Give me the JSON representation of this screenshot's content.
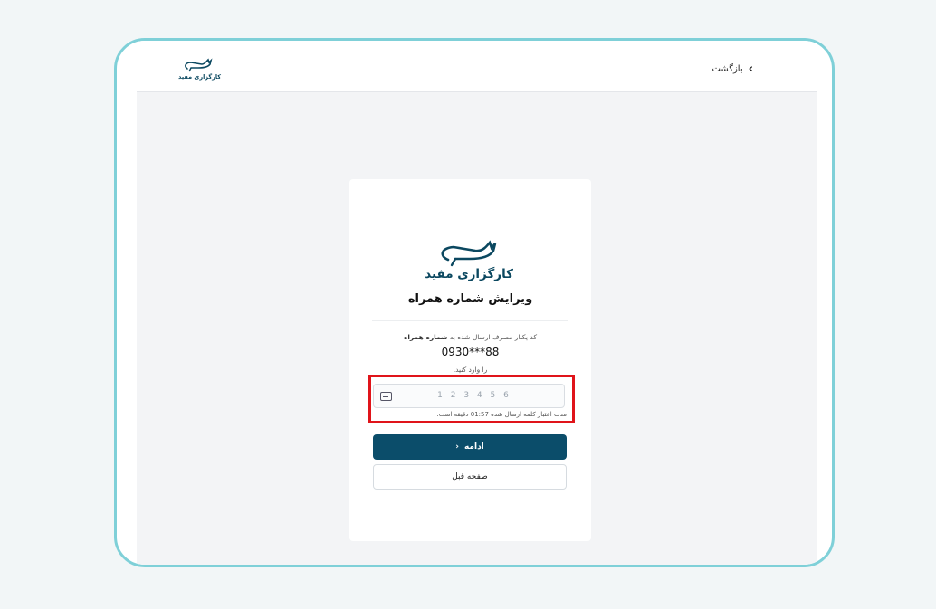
{
  "header": {
    "logo_text": "کارگزاری مفید",
    "back_label": "بازگشت"
  },
  "card": {
    "logo_text": "کارگزاری مفید",
    "title": "ویرایش شماره همراه",
    "message_prefix": "کد یکبار مصرف ارسال شده به",
    "message_bold": "شماره همراه",
    "phone": "0930***88",
    "message_suffix": "را وارد کنید.",
    "otp": {
      "value": "",
      "placeholder": "1 2 3 4 5 6"
    },
    "timer_text": "مدت اعتبار کلمه ارسال شده 01:57 دقیقه است.",
    "continue_label": "ادامه",
    "previous_label": "صفحه قبل"
  },
  "icons": {
    "back": "chevron-left-icon",
    "keyboard": "keyboard-icon",
    "continue": "chevron-left-icon",
    "logo": "bull-logo"
  },
  "colors": {
    "primary": "#0b4d6a",
    "frame": "#7fd0d8",
    "highlight": "#e0141a"
  }
}
